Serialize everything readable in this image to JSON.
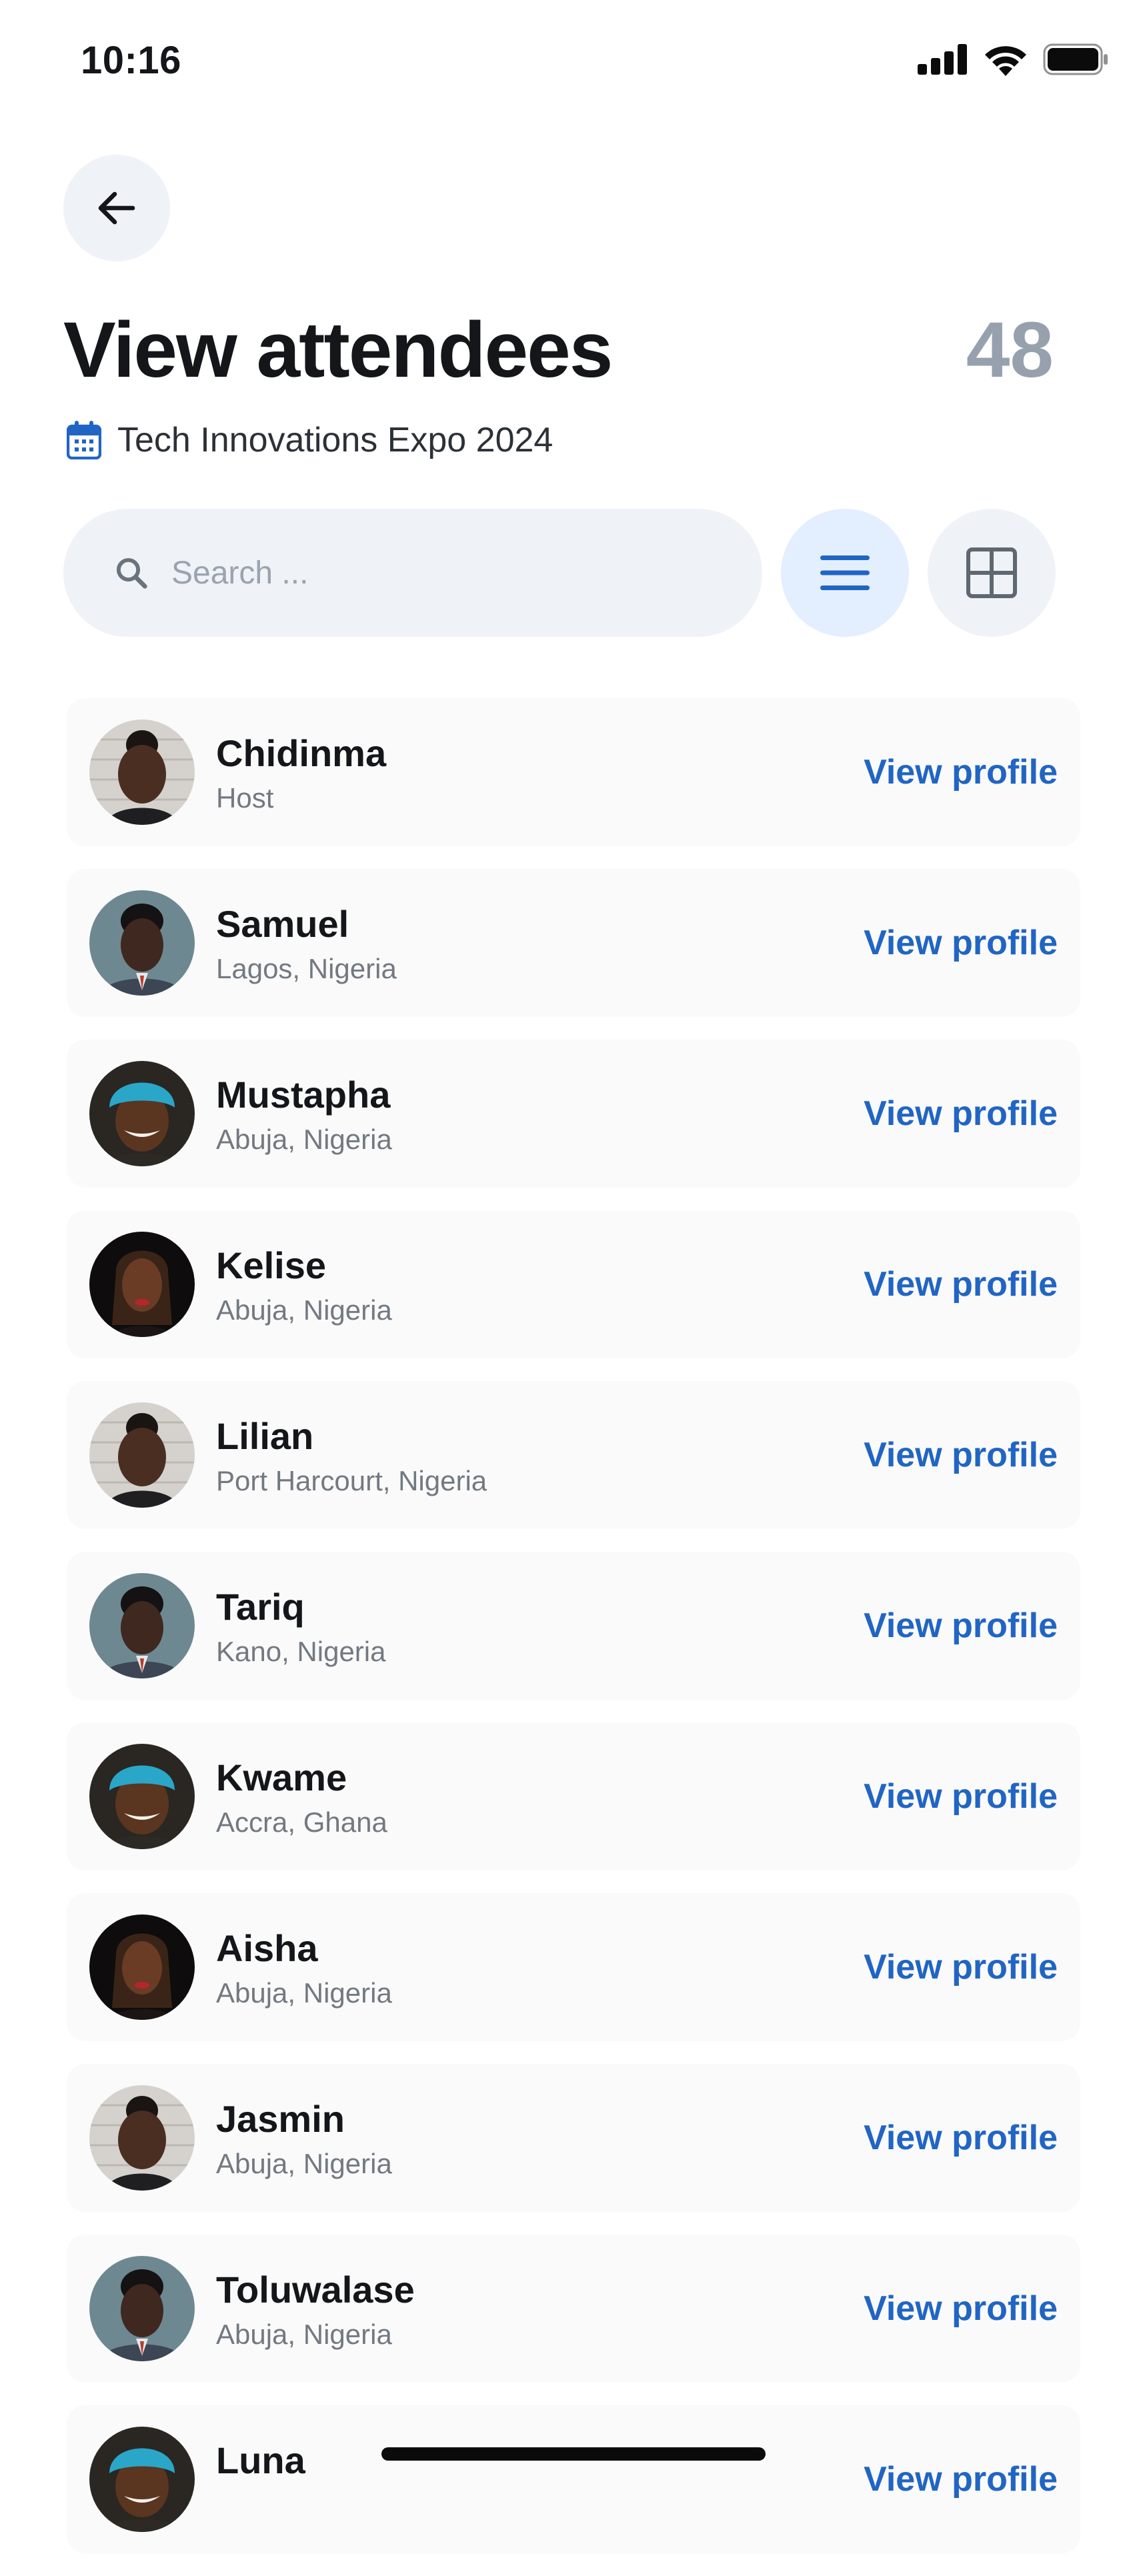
{
  "status_bar": {
    "time": "10:16"
  },
  "header": {
    "title": "View attendees",
    "count": "48",
    "event_name": "Tech Innovations Expo 2024"
  },
  "search": {
    "placeholder": "Search ..."
  },
  "view_toggle": {
    "active": "list"
  },
  "colors": {
    "accent": "#2165c4",
    "accent_bg": "#e3efff",
    "surface": "#eff2f7",
    "row_bg": "#fafafa",
    "muted": "#97a1ad"
  },
  "attendees": [
    {
      "name": "Chidinma",
      "subtitle": "Host",
      "action": "View profile",
      "avatar": "woman-braids"
    },
    {
      "name": "Samuel",
      "subtitle": "Lagos, Nigeria",
      "action": "View profile",
      "avatar": "man-suit"
    },
    {
      "name": "Mustapha",
      "subtitle": "Abuja, Nigeria",
      "action": "View profile",
      "avatar": "man-blue-turban"
    },
    {
      "name": "Kelise",
      "subtitle": "Abuja, Nigeria",
      "action": "View profile",
      "avatar": "woman-red-lips"
    },
    {
      "name": "Lilian",
      "subtitle": "Port Harcourt, Nigeria",
      "action": "View profile",
      "avatar": "woman-braids"
    },
    {
      "name": "Tariq",
      "subtitle": "Kano, Nigeria",
      "action": "View profile",
      "avatar": "man-suit"
    },
    {
      "name": "Kwame",
      "subtitle": "Accra, Ghana",
      "action": "View profile",
      "avatar": "man-blue-turban"
    },
    {
      "name": "Aisha",
      "subtitle": "Abuja, Nigeria",
      "action": "View profile",
      "avatar": "woman-red-lips"
    },
    {
      "name": "Jasmin",
      "subtitle": "Abuja, Nigeria",
      "action": "View profile",
      "avatar": "woman-braids"
    },
    {
      "name": "Toluwalase",
      "subtitle": "Abuja, Nigeria",
      "action": "View profile",
      "avatar": "man-suit"
    },
    {
      "name": "Luna",
      "subtitle": "",
      "action": "View profile",
      "avatar": "man-blue-turban"
    }
  ]
}
